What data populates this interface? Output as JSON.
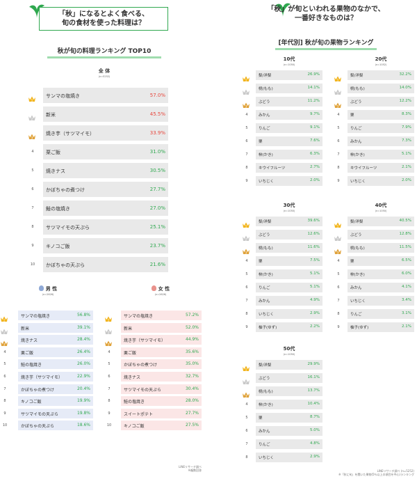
{
  "left": {
    "question": [
      "「秋」になるとよく食べる、",
      "旬の食材を使った料理は？"
    ],
    "heading": "秋が旬の料理ランキング TOP10",
    "overall": {
      "label": "全 体",
      "n": "(n=5252)",
      "rows": [
        {
          "name": "サンマの塩焼き",
          "value": "57.0%"
        },
        {
          "name": "新米",
          "value": "45.5%"
        },
        {
          "name": "焼き芋（サツマイモ）",
          "value": "33.9%"
        },
        {
          "name": "栗ご飯",
          "value": "31.0%"
        },
        {
          "name": "焼きナス",
          "value": "30.5%"
        },
        {
          "name": "かぼちゃの煮つけ",
          "value": "27.7%"
        },
        {
          "name": "鮭の塩焼き",
          "value": "27.0%"
        },
        {
          "name": "サツマイモの天ぷら",
          "value": "25.1%"
        },
        {
          "name": "キノコご飯",
          "value": "23.7%"
        },
        {
          "name": "かぼちゃの天ぷら",
          "value": "21.6%"
        }
      ]
    },
    "male": {
      "label": "男 性",
      "n": "(n=2626)",
      "rows": [
        {
          "name": "サンマの塩焼き",
          "value": "56.8%"
        },
        {
          "name": "新米",
          "value": "39.1%"
        },
        {
          "name": "焼きナス",
          "value": "28.4%"
        },
        {
          "name": "栗ご飯",
          "value": "26.4%"
        },
        {
          "name": "鮭の塩焼き",
          "value": "26.0%"
        },
        {
          "name": "焼き芋（サツマイモ）",
          "value": "22.9%"
        },
        {
          "name": "かぼちゃの煮つけ",
          "value": "20.4%"
        },
        {
          "name": "キノコご飯",
          "value": "19.9%"
        },
        {
          "name": "サツマイモの天ぷら",
          "value": "19.8%"
        },
        {
          "name": "かぼちゃの天ぷら",
          "value": "18.6%"
        }
      ]
    },
    "female": {
      "label": "女 性",
      "n": "(n=2626)",
      "rows": [
        {
          "name": "サンマの塩焼き",
          "value": "57.2%"
        },
        {
          "name": "新米",
          "value": "52.0%"
        },
        {
          "name": "焼き芋（サツマイモ）",
          "value": "44.9%"
        },
        {
          "name": "栗ご飯",
          "value": "35.6%"
        },
        {
          "name": "かぼちゃの煮つけ",
          "value": "35.0%"
        },
        {
          "name": "焼きナス",
          "value": "32.7%"
        },
        {
          "name": "サツマイモの天ぷら",
          "value": "30.4%"
        },
        {
          "name": "鮭の塩焼き",
          "value": "28.0%"
        },
        {
          "name": "スイートポテト",
          "value": "27.7%"
        },
        {
          "name": "キノコご飯",
          "value": "27.5%"
        }
      ]
    },
    "note": [
      "LINEリサーチ調べ",
      "※複数回答"
    ]
  },
  "right": {
    "question": [
      "「秋」が旬といわれる果物のなかで、",
      "一番好きなものは？"
    ],
    "heading": "[年代別] 秋が旬の果物ランキング",
    "groups": [
      {
        "label": "10代",
        "n": "(n=1050)",
        "rows": [
          {
            "name": "梨/洋梨",
            "value": "26.9%"
          },
          {
            "name": "桃(もも)",
            "value": "14.1%"
          },
          {
            "name": "ぶどう",
            "value": "11.2%"
          },
          {
            "name": "みかん",
            "value": "9.7%"
          },
          {
            "name": "りんご",
            "value": "9.1%"
          },
          {
            "name": "栗",
            "value": "7.6%"
          },
          {
            "name": "柿(かき)",
            "value": "6.3%"
          },
          {
            "name": "キウイフルーツ",
            "value": "2.7%"
          },
          {
            "name": "いちじく",
            "value": "2.0%"
          }
        ]
      },
      {
        "label": "20代",
        "n": "(n=1052)",
        "rows": [
          {
            "name": "梨/洋梨",
            "value": "32.2%"
          },
          {
            "name": "桃(もも)",
            "value": "14.0%"
          },
          {
            "name": "ぶどう",
            "value": "12.2%"
          },
          {
            "name": "栗",
            "value": "8.3%"
          },
          {
            "name": "りんご",
            "value": "7.9%"
          },
          {
            "name": "みかん",
            "value": "7.3%"
          },
          {
            "name": "柿(かき)",
            "value": "5.1%"
          },
          {
            "name": "キウイフルーツ",
            "value": "2.1%"
          },
          {
            "name": "いちじく",
            "value": "2.0%"
          }
        ]
      },
      {
        "label": "30代",
        "n": "(n=1050)",
        "rows": [
          {
            "name": "梨/洋梨",
            "value": "39.6%"
          },
          {
            "name": "ぶどう",
            "value": "12.6%"
          },
          {
            "name": "桃(もも)",
            "value": "11.6%"
          },
          {
            "name": "栗",
            "value": "7.5%"
          },
          {
            "name": "柿(かき)",
            "value": "5.1%"
          },
          {
            "name": "りんご",
            "value": "5.1%"
          },
          {
            "name": "みかん",
            "value": "4.9%"
          },
          {
            "name": "いちじく",
            "value": "2.9%"
          },
          {
            "name": "柚子(ゆず)",
            "value": "2.2%"
          }
        ]
      },
      {
        "label": "40代",
        "n": "(n=1050)",
        "rows": [
          {
            "name": "梨/洋梨",
            "value": "40.5%"
          },
          {
            "name": "ぶどう",
            "value": "12.8%"
          },
          {
            "name": "桃(もも)",
            "value": "11.5%"
          },
          {
            "name": "栗",
            "value": "6.5%"
          },
          {
            "name": "柿(かき)",
            "value": "6.0%"
          },
          {
            "name": "みかん",
            "value": "4.1%"
          },
          {
            "name": "いちじく",
            "value": "3.4%"
          },
          {
            "name": "りんご",
            "value": "3.1%"
          },
          {
            "name": "柚子(ゆず)",
            "value": "2.1%"
          }
        ]
      },
      {
        "label": "50代",
        "n": "(n=1050)",
        "rows": [
          {
            "name": "梨/洋梨",
            "value": "29.9%"
          },
          {
            "name": "ぶどう",
            "value": "16.1%"
          },
          {
            "name": "桃(もも)",
            "value": "13.7%"
          },
          {
            "name": "柿(かき)",
            "value": "10.4%"
          },
          {
            "name": "栗",
            "value": "8.7%"
          },
          {
            "name": "みかん",
            "value": "5.0%"
          },
          {
            "name": "りんご",
            "value": "4.8%"
          },
          {
            "name": "いちじく",
            "value": "2.9%"
          }
        ]
      }
    ],
    "note": [
      "LINEリサーチ調べ (n=5252)",
      "※「秋に旬」を聞いた果物(5％以上の項目を中心)ランキング"
    ]
  },
  "colors": {
    "green": "#2fa84f",
    "red": "#e8463c",
    "gray_bar": "#e9e9e9",
    "male_bar": "#e6ebf7",
    "female_bar": "#fbe6e6",
    "gold": "#f2b51f",
    "silver": "#c9c9c9",
    "bronze": "#e0a33c"
  },
  "chart_data": [
    {
      "type": "bar",
      "title": "秋が旬の料理ランキング TOP10",
      "series": [
        {
          "name": "全 体",
          "categories": [
            "サンマの塩焼き",
            "新米",
            "焼き芋（サツマイモ）",
            "栗ご飯",
            "焼きナス",
            "かぼちゃの煮つけ",
            "鮭の塩焼き",
            "サツマイモの天ぷら",
            "キノコご飯",
            "かぼちゃの天ぷら"
          ],
          "values": [
            57.0,
            45.5,
            33.9,
            31.0,
            30.5,
            27.7,
            27.0,
            25.1,
            23.7,
            21.6
          ]
        },
        {
          "name": "男 性",
          "categories": [
            "サンマの塩焼き",
            "新米",
            "焼きナス",
            "栗ご飯",
            "鮭の塩焼き",
            "焼き芋（サツマイモ）",
            "かぼちゃの煮つけ",
            "キノコご飯",
            "サツマイモの天ぷら",
            "かぼちゃの天ぷら"
          ],
          "values": [
            56.8,
            39.1,
            28.4,
            26.4,
            26.0,
            22.9,
            20.4,
            19.9,
            19.8,
            18.6
          ]
        },
        {
          "name": "女 性",
          "categories": [
            "サンマの塩焼き",
            "新米",
            "焼き芋（サツマイモ）",
            "栗ご飯",
            "かぼちゃの煮つけ",
            "焼きナス",
            "サツマイモの天ぷら",
            "鮭の塩焼き",
            "スイートポテト",
            "キノコご飯"
          ],
          "values": [
            57.2,
            52.0,
            44.9,
            35.6,
            35.0,
            32.7,
            30.4,
            28.0,
            27.7,
            27.5
          ]
        }
      ]
    },
    {
      "type": "bar",
      "title": "[年代別] 秋が旬の果物ランキング",
      "series": [
        {
          "name": "10代",
          "categories": [
            "梨/洋梨",
            "桃(もも)",
            "ぶどう",
            "みかん",
            "りんご",
            "栗",
            "柿(かき)",
            "キウイフルーツ",
            "いちじく"
          ],
          "values": [
            26.9,
            14.1,
            11.2,
            9.7,
            9.1,
            7.6,
            6.3,
            2.7,
            2.0
          ]
        },
        {
          "name": "20代",
          "categories": [
            "梨/洋梨",
            "桃(もも)",
            "ぶどう",
            "栗",
            "りんご",
            "みかん",
            "柿(かき)",
            "キウイフルーツ",
            "いちじく"
          ],
          "values": [
            32.2,
            14.0,
            12.2,
            8.3,
            7.9,
            7.3,
            5.1,
            2.1,
            2.0
          ]
        },
        {
          "name": "30代",
          "categories": [
            "梨/洋梨",
            "ぶどう",
            "桃(もも)",
            "栗",
            "柿(かき)",
            "りんご",
            "みかん",
            "いちじく",
            "柚子(ゆず)"
          ],
          "values": [
            39.6,
            12.6,
            11.6,
            7.5,
            5.1,
            5.1,
            4.9,
            2.9,
            2.2
          ]
        },
        {
          "name": "40代",
          "categories": [
            "梨/洋梨",
            "ぶどう",
            "桃(もも)",
            "栗",
            "柿(かき)",
            "みかん",
            "いちじく",
            "りんご",
            "柚子(ゆず)"
          ],
          "values": [
            40.5,
            12.8,
            11.5,
            6.5,
            6.0,
            4.1,
            3.4,
            3.1,
            2.1
          ]
        },
        {
          "name": "50代",
          "categories": [
            "梨/洋梨",
            "ぶどう",
            "桃(もも)",
            "柿(かき)",
            "栗",
            "みかん",
            "りんご",
            "いちじく"
          ],
          "values": [
            29.9,
            16.1,
            13.7,
            10.4,
            8.7,
            5.0,
            4.8,
            2.9
          ]
        }
      ]
    }
  ]
}
